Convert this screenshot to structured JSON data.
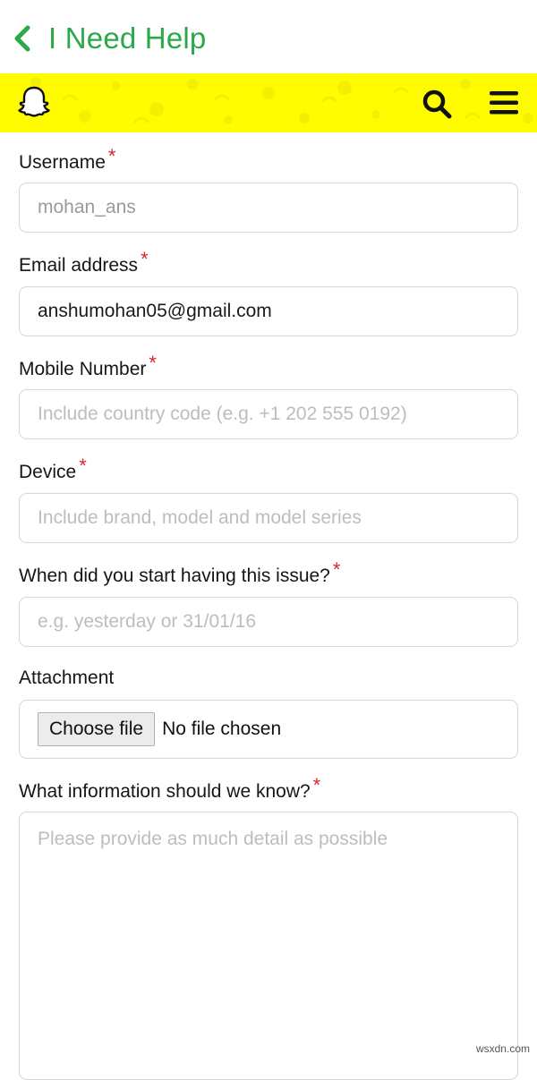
{
  "header": {
    "title": "I Need Help",
    "back_icon": "chevron-left-icon",
    "accent_color": "#2aa84a"
  },
  "brandbar": {
    "background_color": "#fffc00",
    "logo_icon": "snapchat-ghost-icon",
    "search_icon": "search-icon",
    "menu_icon": "hamburger-menu-icon"
  },
  "form": {
    "required_mark": "*",
    "username": {
      "label": "Username",
      "value": "mohan_ans"
    },
    "email": {
      "label": "Email address",
      "value": "anshumohan05@gmail.com"
    },
    "mobile": {
      "label": "Mobile Number",
      "placeholder": "Include country code (e.g. +1 202 555 0192)"
    },
    "device": {
      "label": "Device",
      "placeholder": "Include brand, model and model series"
    },
    "issue_start": {
      "label": "When did you start having this issue?",
      "placeholder": "e.g. yesterday or 31/01/16"
    },
    "attachment": {
      "label": "Attachment",
      "button_label": "Choose file",
      "status": "No file chosen"
    },
    "details": {
      "label": "What information should we know?",
      "placeholder": "Please provide as much detail as possible"
    }
  },
  "watermark": "wsxdn.com"
}
